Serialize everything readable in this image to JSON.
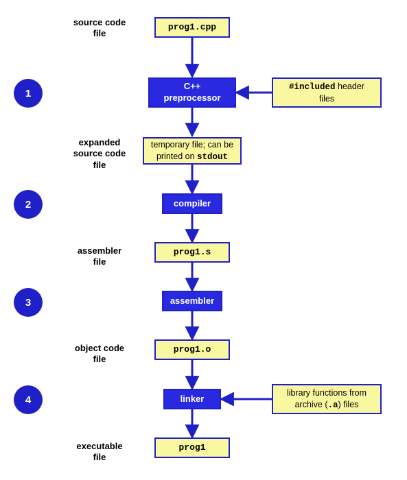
{
  "labels": {
    "source": "source code\nfile",
    "expanded": "expanded\nsource code\nfile",
    "asm": "assembler\nfile",
    "obj": "object code\nfile",
    "exe": "executable\nfile"
  },
  "steps": {
    "s1": "1",
    "s2": "2",
    "s3": "3",
    "s4": "4"
  },
  "files": {
    "source": "prog1.cpp",
    "asm": "prog1.s",
    "obj": "prog1.o",
    "exe": "prog1"
  },
  "stages": {
    "pre": "C++\npreprocessor",
    "compiler": "compiler",
    "assembler": "assembler",
    "linker": "linker"
  },
  "inputs": {
    "headers_pre": "#included",
    "headers_post": " header\nfiles",
    "libs_pre": "library functions from\narchive (",
    "libs_mono": ".a",
    "libs_post": ") files"
  },
  "temp": {
    "pre": "temporary  file; can be\nprinted on ",
    "mono": "stdout"
  }
}
